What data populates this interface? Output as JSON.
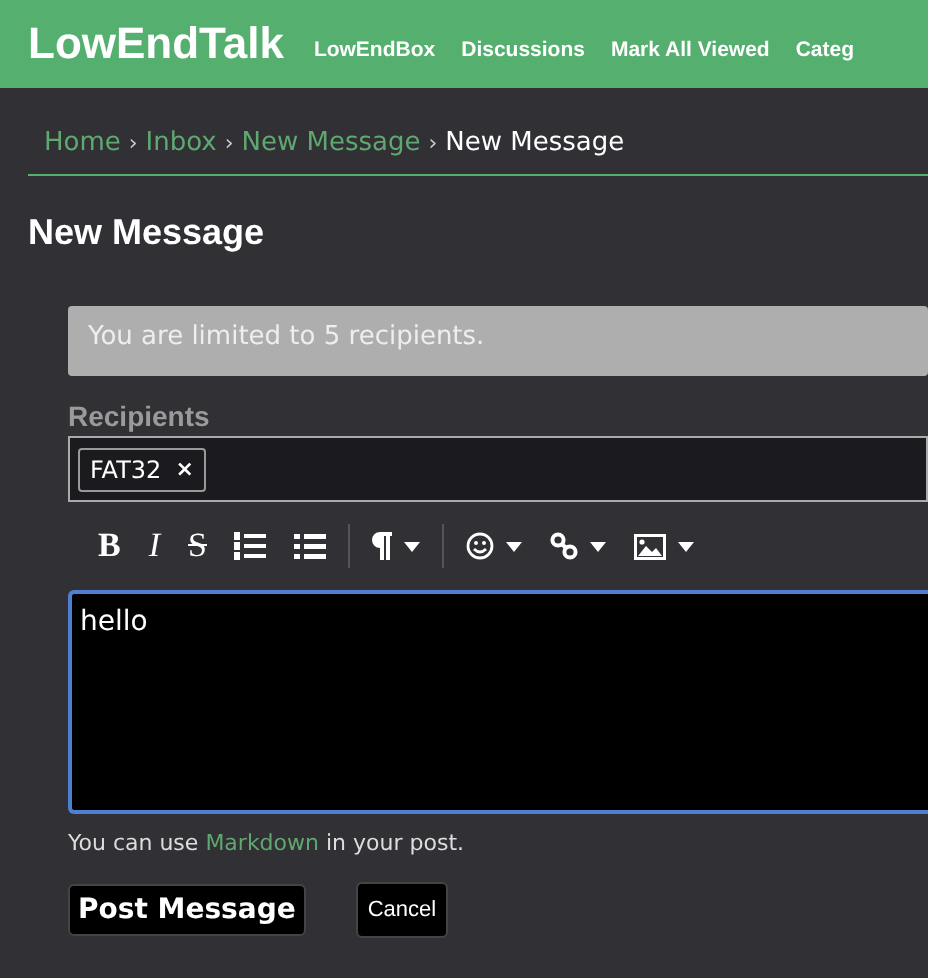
{
  "header": {
    "logo": "LowEndTalk",
    "nav": [
      "LowEndBox",
      "Discussions",
      "Mark All Viewed",
      "Categ"
    ]
  },
  "breadcrumbs": [
    {
      "label": "Home",
      "link": true
    },
    {
      "label": "Inbox",
      "link": true
    },
    {
      "label": "New Message",
      "link": true
    },
    {
      "label": "New Message",
      "link": false
    }
  ],
  "breadcrumb_separator": "›",
  "page_title": "New Message",
  "notice": "You are limited to 5 recipients.",
  "recipients": {
    "label": "Recipients",
    "tokens": [
      {
        "name": "FAT32",
        "remove": "×"
      }
    ]
  },
  "toolbar": [
    {
      "kind": "bold",
      "label": "B"
    },
    {
      "kind": "italic",
      "label": "I"
    },
    {
      "kind": "strike",
      "label": "S"
    },
    {
      "kind": "ordered-list"
    },
    {
      "kind": "bullet-list"
    },
    {
      "kind": "separator"
    },
    {
      "kind": "paragraph",
      "dropdown": true
    },
    {
      "kind": "separator"
    },
    {
      "kind": "emoji",
      "dropdown": true
    },
    {
      "kind": "link",
      "dropdown": true
    },
    {
      "kind": "image",
      "dropdown": true
    }
  ],
  "body": {
    "value": "hello"
  },
  "hint": {
    "before": "You can use ",
    "link": "Markdown",
    "after": " in your post."
  },
  "buttons": [
    {
      "label": "Post Message",
      "kind": "primary"
    },
    {
      "label": "Cancel",
      "kind": "secondary"
    }
  ]
}
